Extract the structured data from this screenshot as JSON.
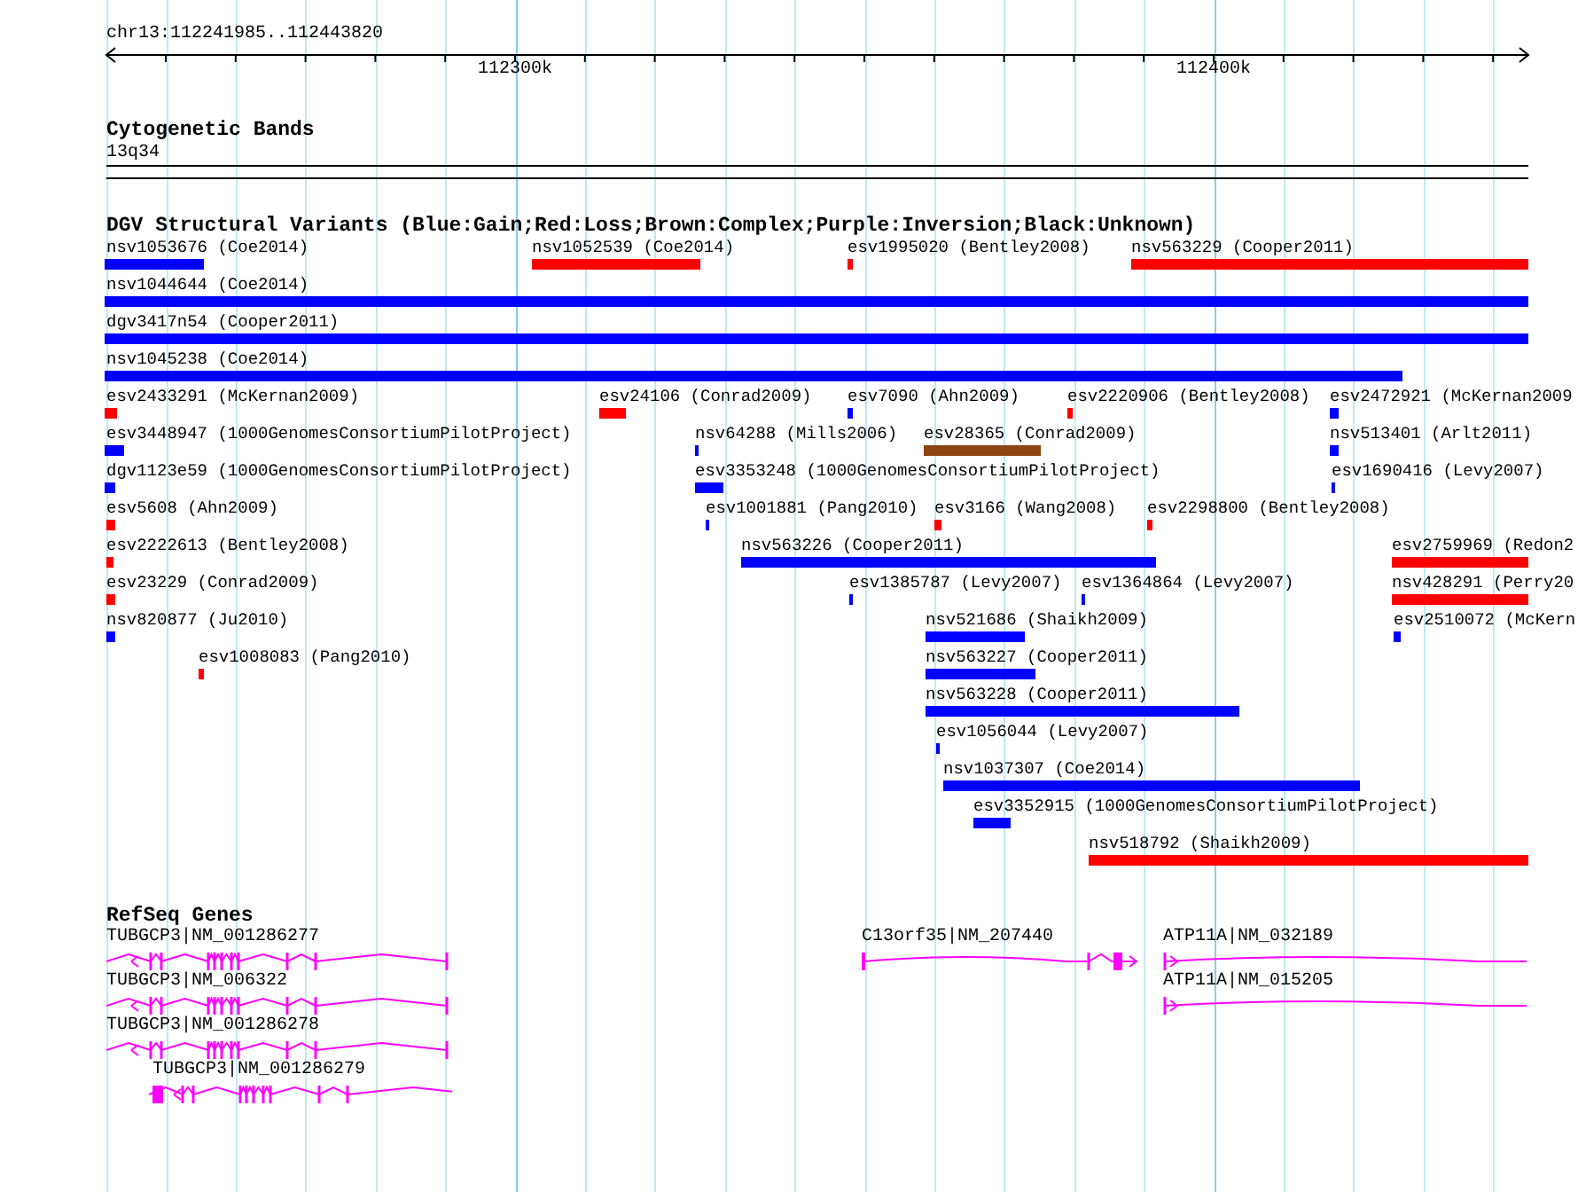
{
  "ruler": {
    "location": "chr13:112241985..112443820",
    "tick_labels": [
      "112300k",
      "112400k"
    ]
  },
  "cytogenetic_bands": {
    "title": "Cytogenetic Bands",
    "bands": [
      "13q34"
    ]
  },
  "structural_variants": {
    "title": "DGV Structural Variants (Blue:Gain;Red:Loss;Brown:Complex;Purple:Inversion;Black:Unknown)",
    "features": [
      {
        "label": "nsv1053676 (Coe2014)",
        "color": "#0000ff"
      },
      {
        "label": "nsv1052539 (Coe2014)",
        "color": "#ff0000"
      },
      {
        "label": "esv1995020 (Bentley2008)",
        "color": "#ff0000"
      },
      {
        "label": "nsv563229 (Cooper2011)",
        "color": "#ff0000"
      },
      {
        "label": "nsv1044644 (Coe2014)",
        "color": "#0000ff"
      },
      {
        "label": "dgv3417n54 (Cooper2011)",
        "color": "#0000ff"
      },
      {
        "label": "nsv1045238 (Coe2014)",
        "color": "#0000ff"
      },
      {
        "label": "esv2433291 (McKernan2009)",
        "color": "#ff0000"
      },
      {
        "label": "esv24106 (Conrad2009)",
        "color": "#ff0000"
      },
      {
        "label": "esv7090 (Ahn2009)",
        "color": "#0000ff"
      },
      {
        "label": "esv2220906 (Bentley2008)",
        "color": "#ff0000"
      },
      {
        "label": "esv2472921 (McKernan2009",
        "color": "#0000ff"
      },
      {
        "label": "esv3448947 (1000GenomesConsortiumPilotProject)",
        "color": "#0000ff"
      },
      {
        "label": "nsv64288 (Mills2006)",
        "color": "#0000ff"
      },
      {
        "label": "esv28365 (Conrad2009)",
        "color": "#8b4513"
      },
      {
        "label": "nsv513401 (Arlt2011)",
        "color": "#0000ff"
      },
      {
        "label": "dgv1123e59 (1000GenomesConsortiumPilotProject)",
        "color": "#0000ff"
      },
      {
        "label": "esv3353248 (1000GenomesConsortiumPilotProject)",
        "color": "#0000ff"
      },
      {
        "label": "esv1690416 (Levy2007)",
        "color": "#0000ff"
      },
      {
        "label": "esv5608 (Ahn2009)",
        "color": "#ff0000"
      },
      {
        "label": "esv1001881 (Pang2010)",
        "color": "#0000ff"
      },
      {
        "label": "esv3166 (Wang2008)",
        "color": "#ff0000"
      },
      {
        "label": "esv2298800 (Bentley2008)",
        "color": "#ff0000"
      },
      {
        "label": "esv2222613 (Bentley2008)",
        "color": "#ff0000"
      },
      {
        "label": "nsv563226 (Cooper2011)",
        "color": "#0000ff"
      },
      {
        "label": "esv2759969 (Redon2",
        "color": "#ff0000"
      },
      {
        "label": "esv23229 (Conrad2009)",
        "color": "#ff0000"
      },
      {
        "label": "esv1385787 (Levy2007)",
        "color": "#0000ff"
      },
      {
        "label": "esv1364864 (Levy2007)",
        "color": "#0000ff"
      },
      {
        "label": "nsv428291 (Perry20",
        "color": "#ff0000"
      },
      {
        "label": "nsv820877 (Ju2010)",
        "color": "#0000ff"
      },
      {
        "label": "nsv521686 (Shaikh2009)",
        "color": "#0000ff"
      },
      {
        "label": "esv2510072 (McKern",
        "color": "#0000ff"
      },
      {
        "label": "esv1008083 (Pang2010)",
        "color": "#ff0000"
      },
      {
        "label": "nsv563227 (Cooper2011)",
        "color": "#0000ff"
      },
      {
        "label": "nsv563228 (Cooper2011)",
        "color": "#0000ff"
      },
      {
        "label": "esv1056044 (Levy2007)",
        "color": "#0000ff"
      },
      {
        "label": "nsv1037307 (Coe2014)",
        "color": "#0000ff"
      },
      {
        "label": "esv3352915 (1000GenomesConsortiumPilotProject)",
        "color": "#0000ff"
      },
      {
        "label": "nsv518792 (Shaikh2009)",
        "color": "#ff0000"
      }
    ]
  },
  "refseq_genes": {
    "title": "RefSeq Genes",
    "features": [
      {
        "label": "TUBGCP3|NM_001286277"
      },
      {
        "label": "TUBGCP3|NM_006322"
      },
      {
        "label": "TUBGCP3|NM_001286278"
      },
      {
        "label": "TUBGCP3|NM_001286279"
      },
      {
        "label": "C13orf35|NM_207440"
      },
      {
        "label": "ATP11A|NM_032189"
      },
      {
        "label": "ATP11A|NM_015205"
      }
    ]
  }
}
